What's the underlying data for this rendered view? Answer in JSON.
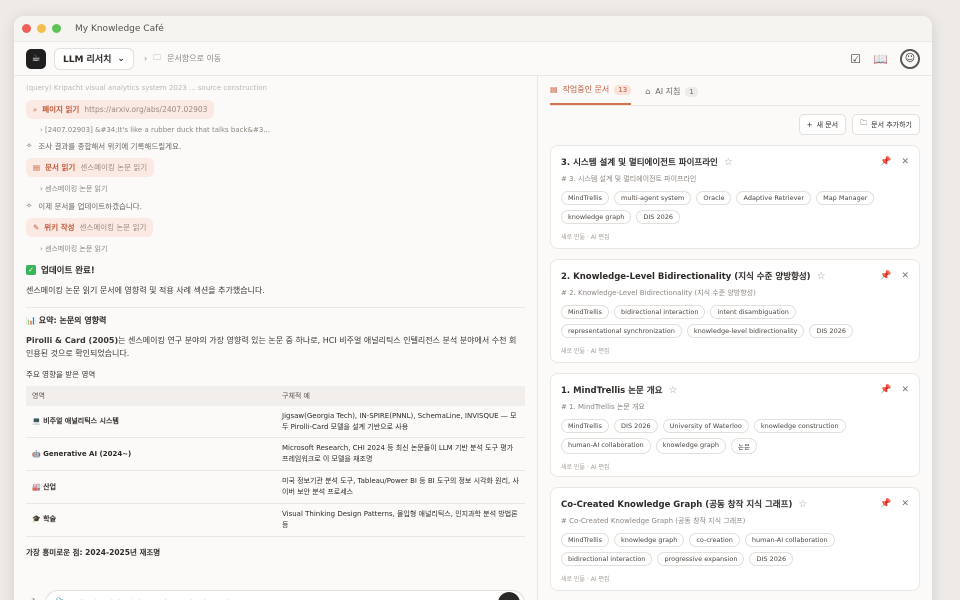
{
  "window": {
    "title": "My Knowledge Café"
  },
  "toolbar": {
    "model": "LLM 리서치",
    "crumb": "문서함으로 이동"
  },
  "chat": {
    "faded_top": "(query) Kripacht visual analytics system 2023 ... source construction",
    "steps": [
      {
        "label": "페이지 읽기",
        "arg": "https://arxiv.org/abs/2407.02903",
        "icon": "search-icon",
        "sub": "[2407.02903] &#34;It's like a rubber duck that talks back&#3..."
      },
      {
        "note": "조사 결과를 종합해서 위키에 기록해드릴게요."
      },
      {
        "label": "문서 읽기",
        "arg": "센스메이킹 논문 읽기",
        "icon": "document-icon",
        "sub": "센스메이킹 논문 읽기"
      },
      {
        "note": "이제 문서를 업데이트하겠습니다."
      },
      {
        "label": "위키 작성",
        "arg": "센스메이킹 논문 읽기",
        "icon": "pencil-icon",
        "sub": "센스메이킹 논문 읽기"
      }
    ],
    "update_title": "업데이트 완료!",
    "update_body": "센스메이킹 논문 읽기 문서에 영향력 및 적용 사례 섹션을 추가했습니다.",
    "summary_title": "요약: 논문의 영향력",
    "summary_lead": "Pirolli & Card (2005)",
    "summary_rest": "는 센스메이킹 연구 분야의 가장 영향력 있는 논문 중 하나로, HCI 비주얼 애널리틱스 인텔리전스 분석 분야에서 수천 회 인용된 것으로 확인되었습니다.",
    "table_caption": "주요 영향을 받은 영역",
    "table": {
      "headers": [
        "영역",
        "구체적 예"
      ],
      "rows": [
        {
          "area": "💻 비주얼 애널리틱스 시스템",
          "example": "Jigsaw(Georgia Tech), IN-SPIRE(PNNL), SchemaLine, INVISQUE — 모두 Pirolli-Card 모델을 설계 기반으로 사용"
        },
        {
          "area": "🤖 Generative AI (2024~)",
          "example": "Microsoft Research, CHI 2024 등 최신 논문들이 LLM 기반 분석 도구 평가 프레임워크로 이 모델을 재조명"
        },
        {
          "area": "🏭 산업",
          "example": "미국 정보기관 분석 도구, Tableau/Power BI 등 BI 도구의 정보 시각화 원리, 사이버 보안 분석 프로세스"
        },
        {
          "area": "🎓 학술",
          "example": "Visual Thinking Design Patterns, 몰입형 애널리틱스, 인지과학 분석 방법론 등"
        }
      ]
    },
    "footer_note": "가장 흥미로운 점: 2024-2025년 재조명",
    "input_placeholder": "메시지를 입력하거나, @문서 로 문서를 추가하세요"
  },
  "side": {
    "tabs": [
      {
        "label": "작업중인 문서",
        "count": "13"
      },
      {
        "label": "AI 지침",
        "count": "1"
      }
    ],
    "new_doc": "새 문서",
    "add_doc": "문서 추가하기",
    "cards": [
      {
        "title": "3. 시스템 설계 및 멀티에이전트 파이프라인",
        "sub": "# 3. 시스템 설계 및 멀티에이전트 파이프라인",
        "chips": [
          "MindTrellis",
          "multi-agent system",
          "Oracle",
          "Adaptive Retriever",
          "Map Manager",
          "knowledge graph",
          "DIS 2026"
        ],
        "meta": "새로 만듦 · AI 편집"
      },
      {
        "title": "2. Knowledge-Level Bidirectionality (지식 수준 양방향성)",
        "sub": "# 2. Knowledge-Level Bidirectionality (지식 수준 양방향성)",
        "chips": [
          "MindTrellis",
          "bidirectional interaction",
          "intent disambiguation",
          "representational synchronization",
          "knowledge-level bidirectionality",
          "DIS 2026"
        ],
        "meta": "새로 만듦 · AI 편집"
      },
      {
        "title": "1. MindTrellis 논문 개요",
        "sub": "# 1. MindTrellis 논문 개요",
        "chips": [
          "MindTrellis",
          "DIS 2026",
          "University of Waterloo",
          "knowledge construction",
          "human-AI collaboration",
          "knowledge graph",
          "논문"
        ],
        "meta": "새로 만듦 · AI 편집"
      },
      {
        "title": "Co-Created Knowledge Graph (공동 창작 지식 그래프)",
        "sub": "# Co-Created Knowledge Graph (공동 창작 지식 그래프)",
        "chips": [
          "MindTrellis",
          "knowledge graph",
          "co-creation",
          "human-AI collaboration",
          "bidirectional interaction",
          "progressive expansion",
          "DIS 2026"
        ],
        "meta": "새로 만듦 · AI 편집"
      }
    ]
  },
  "colors": {
    "accent": "#d6734f",
    "accent_bg": "#fbe9e3",
    "success": "#3bb55c"
  }
}
